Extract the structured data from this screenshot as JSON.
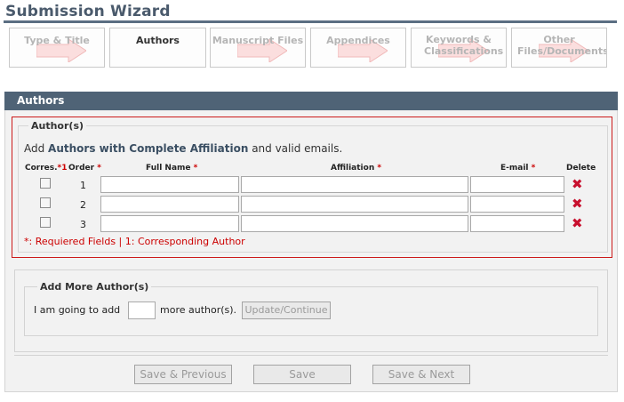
{
  "wizard": {
    "title": "Submission Wizard"
  },
  "steps": [
    {
      "label": "Type & Title"
    },
    {
      "label": "Authors"
    },
    {
      "label": "Manuscript Files"
    },
    {
      "label": "Appendices"
    },
    {
      "label": "Keywords & Classifications"
    },
    {
      "label": "Other Files/Documents"
    }
  ],
  "panel": {
    "title": "Authors"
  },
  "authors": {
    "legend": "Author(s)",
    "intro_prefix": "Add ",
    "intro_highlight": "Authors with Complete Affiliation",
    "intro_suffix": " and valid emails.",
    "columns": {
      "corres": "Corres.",
      "corres_req": "*1",
      "order": "Order",
      "full_name": "Full Name",
      "affiliation": "Affiliation",
      "email": "E-mail",
      "delete": "Delete",
      "required_mark": "*"
    },
    "rows": [
      {
        "order": "1",
        "full_name": "",
        "affiliation": "",
        "email": ""
      },
      {
        "order": "2",
        "full_name": "",
        "affiliation": "",
        "email": ""
      },
      {
        "order": "3",
        "full_name": "",
        "affiliation": "",
        "email": ""
      }
    ],
    "delete_glyph": "✖",
    "footnote": "*: Requiered Fields | 1: Corresponding Author"
  },
  "add_more": {
    "legend": "Add More Author(s)",
    "prefix": "I am going to add",
    "suffix": "more author(s).",
    "count_value": "",
    "update_label": "Update/Continue"
  },
  "actions": {
    "previous_label": "Save & Previous",
    "save_label": "Save",
    "next_label": "Save & Next"
  },
  "colors": {
    "header_bg": "#4f6376",
    "error_border": "#cc1a1a",
    "required": "#cc0000",
    "delete": "#c8102e",
    "step_arrow": "#f8d0d0"
  }
}
